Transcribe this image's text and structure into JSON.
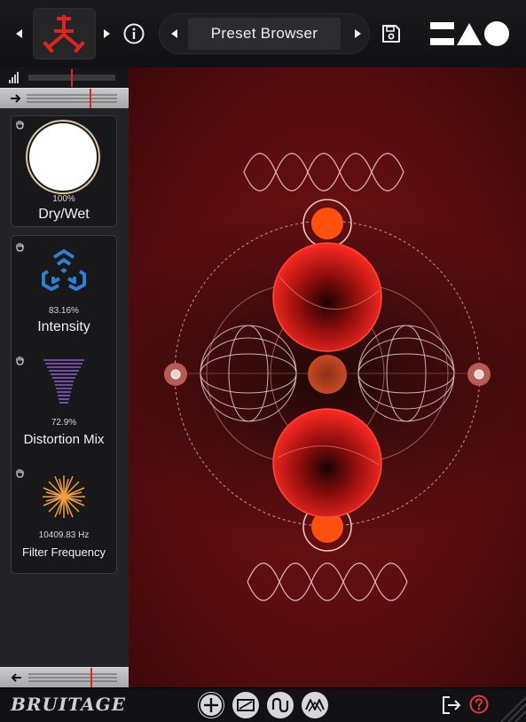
{
  "header": {
    "preset_name": "Preset Browser"
  },
  "controls": {
    "dry_wet": {
      "value": "100%",
      "label": "Dry/Wet"
    },
    "intensity": {
      "value": "83.16%",
      "label": "Intensity"
    },
    "distortion_mix": {
      "value": "72.9%",
      "label": "Distortion Mix"
    },
    "filter_frequency": {
      "value": "10409.83 Hz",
      "label": "Filter Frequency"
    }
  },
  "footer": {
    "brand": "BRUITAGE"
  },
  "colors": {
    "accent_red": "#e02424",
    "orb_orange": "#ff5010",
    "intensity_blue": "#2f7fd6",
    "distortion_purple": "#8f5ad0",
    "filter_orange": "#f0a03c",
    "help_red": "#e23b3b"
  },
  "icons": [
    "prev-arrow-icon",
    "next-arrow-icon",
    "info-icon",
    "save-icon",
    "hand-icon",
    "plus-icon",
    "waveform-icon",
    "exit-icon",
    "help-icon"
  ]
}
